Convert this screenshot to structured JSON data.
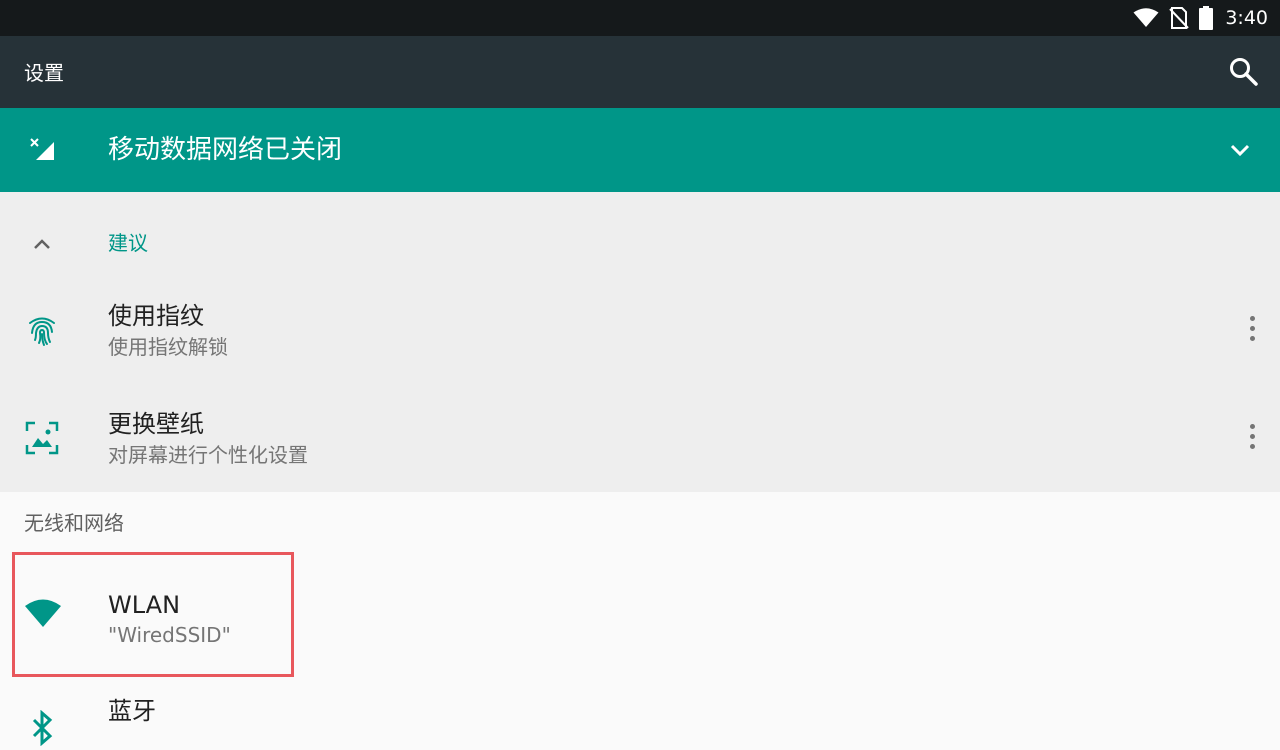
{
  "statusbar": {
    "time": "3:40",
    "icons": [
      "wifi-icon",
      "no-sim-icon",
      "battery-icon"
    ]
  },
  "toolbar": {
    "title": "设置",
    "search_icon": "search-icon"
  },
  "banner": {
    "text": "移动数据网络已关闭",
    "icon": "mobile-data-off-icon",
    "expand_icon": "chevron-down-icon"
  },
  "suggestions": {
    "header": "建议",
    "items": [
      {
        "title": "使用指纹",
        "subtitle": "使用指纹解锁",
        "icon": "fingerprint-icon"
      },
      {
        "title": "更换壁纸",
        "subtitle": "对屏幕进行个性化设置",
        "icon": "wallpaper-icon"
      }
    ]
  },
  "section": {
    "title": "无线和网络",
    "items": [
      {
        "title": "WLAN",
        "subtitle": "\"WiredSSID\"",
        "icon": "wifi-icon"
      },
      {
        "title": "蓝牙",
        "subtitle": "",
        "icon": "bluetooth-icon"
      }
    ]
  },
  "colors": {
    "accent": "#009688",
    "toolbar": "#263238",
    "statusbar": "#15191b",
    "highlight": "#e8575c"
  }
}
